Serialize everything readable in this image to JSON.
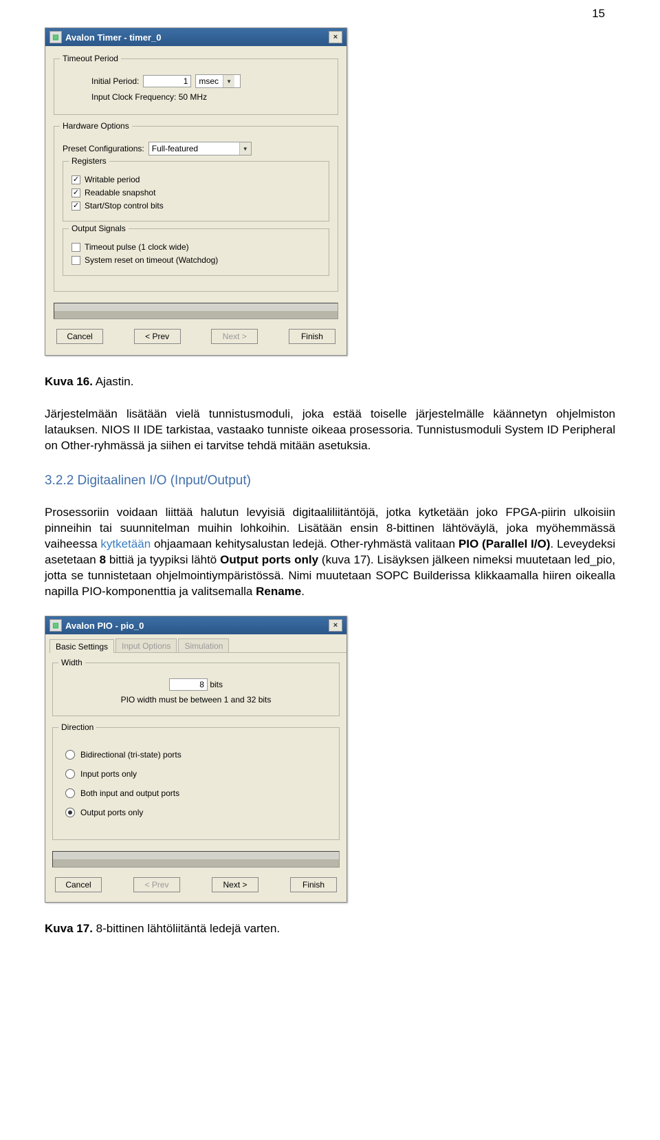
{
  "page_number": "15",
  "dialog1": {
    "title": "Avalon Timer - timer_0",
    "close": "×",
    "timeout_legend": "Timeout Period",
    "initial_period_label": "Initial Period:",
    "initial_period_value": "1",
    "initial_period_unit": "msec",
    "clock_freq": "Input Clock Frequency: 50 MHz",
    "hw_legend": "Hardware Options",
    "preset_label": "Preset Configurations:",
    "preset_value": "Full-featured",
    "registers_legend": "Registers",
    "reg_writable": "Writable period",
    "reg_readable": "Readable snapshot",
    "reg_startstop": "Start/Stop control bits",
    "outsig_legend": "Output Signals",
    "out_pulse": "Timeout pulse (1 clock wide)",
    "out_watchdog": "System reset on timeout (Watchdog)",
    "btn_cancel": "Cancel",
    "btn_prev": "< Prev",
    "btn_next": "Next >",
    "btn_finish": "Finish"
  },
  "caption1_prefix": "Kuva 16.",
  "caption1_text": "Ajastin.",
  "para1": "Järjestelmään lisätään vielä tunnistusmoduli, joka estää toiselle järjestelmälle käännetyn ohjelmiston latauksen. NIOS II IDE tarkistaa, vastaako tunniste oikeaa prosessoria. Tunnistusmoduli System ID Peripheral on Other-ryhmässä ja siihen ei tarvitse tehdä mitään asetuksia.",
  "heading1": "3.2.2 Digitaalinen I/O (Input/Output)",
  "para2_a": "Prosessoriin voidaan liittää halutun levyisiä digitaaliliitäntöjä, jotka kytketään joko FPGA-piirin ulkoisiin pinneihin tai suunnitelman muihin lohkoihin. Lisätään ensin 8-bittinen lähtöväylä, joka myöhemmässä vaiheessa ",
  "para2_link": "kytketään",
  "para2_b": " ohjaamaan kehitysalustan ledejä. Other-ryhmästä valitaan ",
  "para2_bold1": "PIO (Parallel I/O)",
  "para2_c": ". Leveydeksi asetetaan ",
  "para2_bold2": "8",
  "para2_d": " bittiä ja tyypiksi lähtö ",
  "para2_bold3": "Output ports only",
  "para2_e": " (kuva 17). Lisäyksen jälkeen nimeksi muutetaan led_pio, jotta se tunnistetaan ohjelmointiympäristössä. Nimi muutetaan SOPC Builderissa klikkaamalla hiiren oikealla napilla PIO-komponenttia ja valitsemalla ",
  "para2_bold4": "Rename",
  "para2_f": ".",
  "dialog2": {
    "title": "Avalon PIO - pio_0",
    "close": "×",
    "tab1": "Basic Settings",
    "tab2": "Input Options",
    "tab3": "Simulation",
    "width_legend": "Width",
    "width_value": "8",
    "width_unit": "bits",
    "width_hint": "PIO width must be between 1 and 32 bits",
    "direction_legend": "Direction",
    "r1": "Bidirectional (tri-state) ports",
    "r2": "Input ports only",
    "r3": "Both input and output ports",
    "r4": "Output ports only",
    "btn_cancel": "Cancel",
    "btn_prev": "< Prev",
    "btn_next": "Next >",
    "btn_finish": "Finish"
  },
  "caption2_prefix": "Kuva 17.",
  "caption2_text": "8-bittinen lähtöliitäntä ledejä varten."
}
